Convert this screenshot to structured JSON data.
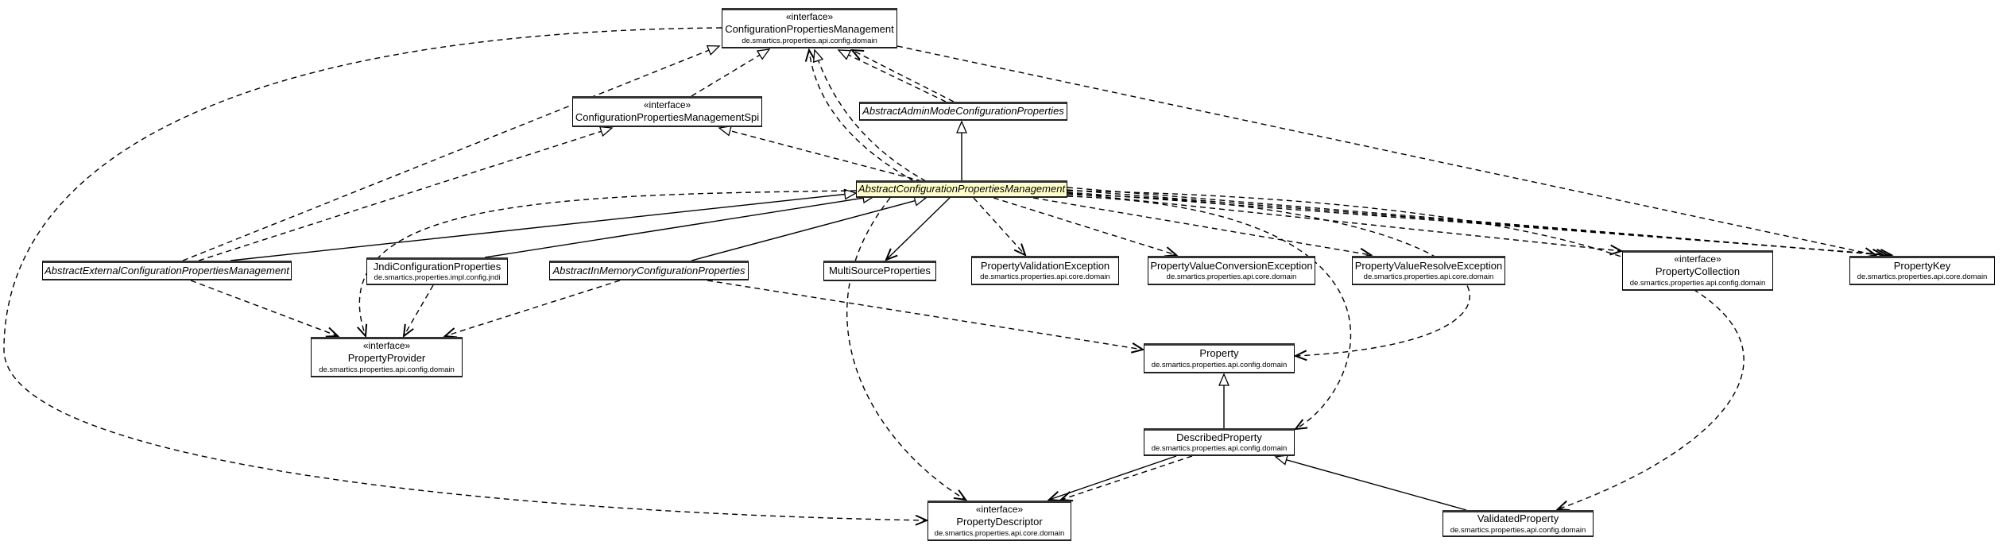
{
  "colors": {
    "highlight": "#ffffcc",
    "box_border": "#000000",
    "edge": "#000000"
  },
  "nodes": {
    "cpm": {
      "stereotype": "«interface»",
      "name": "ConfigurationPropertiesManagement",
      "package": "de.smartics.properties.api.config.domain"
    },
    "cpmspi": {
      "stereotype": "«interface»",
      "name": "ConfigurationPropertiesManagementSpi"
    },
    "aam": {
      "name": "AbstractAdminModeConfigurationProperties"
    },
    "acpm": {
      "name": "AbstractConfigurationPropertiesManagement"
    },
    "aext": {
      "name": "AbstractExternalConfigurationPropertiesManagement"
    },
    "jndi": {
      "name": "JndiConfigurationProperties",
      "package": "de.smartics.properties.impl.config.jndi"
    },
    "ainmem": {
      "name": "AbstractInMemoryConfigurationProperties"
    },
    "multi": {
      "name": "MultiSourceProperties"
    },
    "pve": {
      "name": "PropertyValidationException",
      "package": "de.smartics.properties.api.core.domain"
    },
    "pvce": {
      "name": "PropertyValueConversionException",
      "package": "de.smartics.properties.api.core.domain"
    },
    "pvre": {
      "name": "PropertyValueResolveException",
      "package": "de.smartics.properties.api.core.domain"
    },
    "pcoll": {
      "stereotype": "«interface»",
      "name": "PropertyCollection",
      "package": "de.smartics.properties.api.config.domain"
    },
    "pkey": {
      "name": "PropertyKey",
      "package": "de.smartics.properties.api.core.domain"
    },
    "pprov": {
      "stereotype": "«interface»",
      "name": "PropertyProvider",
      "package": "de.smartics.properties.api.config.domain"
    },
    "prop": {
      "name": "Property",
      "package": "de.smartics.properties.api.config.domain"
    },
    "dprop": {
      "name": "DescribedProperty",
      "package": "de.smartics.properties.api.config.domain"
    },
    "pdesc": {
      "stereotype": "«interface»",
      "name": "PropertyDescriptor",
      "package": "de.smartics.properties.api.core.domain"
    },
    "vprop": {
      "name": "ValidatedProperty",
      "package": "de.smartics.properties.api.config.domain"
    }
  }
}
